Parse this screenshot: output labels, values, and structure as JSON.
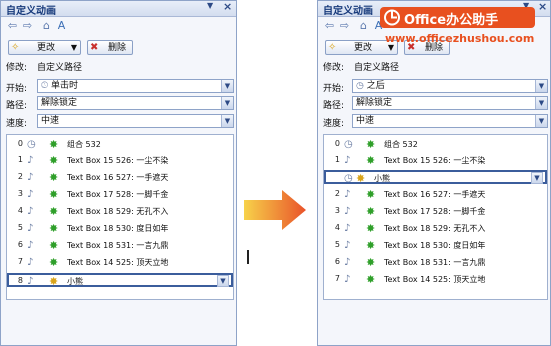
{
  "left_pane": {
    "title": "自定义动画",
    "toolbar": {
      "change_label": "更改",
      "delete_label": "删除"
    },
    "modify_label": "修改:",
    "modify_value": "自定义路径",
    "start_label": "开始:",
    "start_value": "单击时",
    "path_label": "路径:",
    "path_value": "解除锁定",
    "speed_label": "速度:",
    "speed_value": "中速",
    "items": [
      {
        "num": "0",
        "text": "组合 532"
      },
      {
        "num": "1",
        "text": "Text Box 15 526: 一尘不染"
      },
      {
        "num": "2",
        "text": "Text Box 16 527: 一手遮天"
      },
      {
        "num": "3",
        "text": "Text Box 17 528: 一脚千金"
      },
      {
        "num": "4",
        "text": "Text Box 18 529: 无孔不入"
      },
      {
        "num": "5",
        "text": "Text Box 18 530: 度日如年"
      },
      {
        "num": "6",
        "text": "Text Box 18 531: 一言九鼎"
      },
      {
        "num": "7",
        "text": "Text Box 14 525: 顶天立地"
      },
      {
        "num": "8",
        "text": "小熊"
      }
    ]
  },
  "right_pane": {
    "title": "自定义动画",
    "toolbar": {
      "change_label": "更改",
      "delete_label": "删除"
    },
    "modify_label": "修改:",
    "modify_value": "自定义路径",
    "start_label": "开始:",
    "start_value": "之后",
    "path_label": "路径:",
    "path_value": "解除锁定",
    "speed_label": "速度:",
    "speed_value": "中速",
    "items": [
      {
        "num": "0",
        "text": "组合 532"
      },
      {
        "num": "1",
        "text": "Text Box 15 526: 一尘不染"
      },
      {
        "num": "",
        "text": "小熊"
      },
      {
        "num": "2",
        "text": "Text Box 16 527: 一手遮天"
      },
      {
        "num": "3",
        "text": "Text Box 17 528: 一脚千金"
      },
      {
        "num": "4",
        "text": "Text Box 18 529: 无孔不入"
      },
      {
        "num": "5",
        "text": "Text Box 18 530: 度日如年"
      },
      {
        "num": "6",
        "text": "Text Box 18 531: 一言九鼎"
      },
      {
        "num": "7",
        "text": "Text Box 14 525: 顶天立地"
      }
    ]
  },
  "watermark": {
    "title": "Office办公助手",
    "url": "www.officezhushou.com"
  },
  "colors": {
    "accent": "#3b5d9c",
    "pane_bg": "#f4f6fb",
    "title_text": "#15387a",
    "brand": "#e8501f",
    "arrow_from": "#f7d24a",
    "arrow_to": "#e9532a"
  }
}
